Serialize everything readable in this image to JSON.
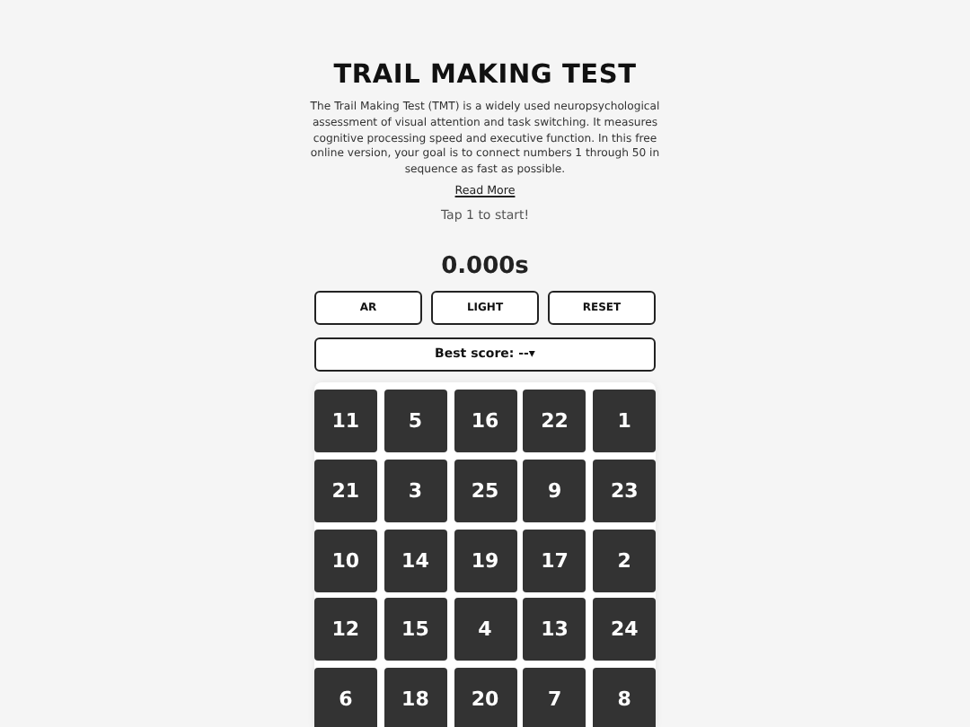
{
  "title": "TRAIL MAKING TEST",
  "description": "The Trail Making Test (TMT) is a widely used neuropsychological assessment of visual attention and task switching. It measures cognitive processing speed and executive function. In this free online version, your goal is to connect numbers 1 through 50 in sequence as fast as possible.",
  "read_more": "Read More",
  "hint": "Tap 1 to start!",
  "timer": "0.000s",
  "buttons": [
    "AR",
    "LIGHT",
    "RESET"
  ],
  "best_score": "Best score: --▾",
  "tiles": [
    "11",
    "5",
    "16",
    "22",
    "1",
    "21",
    "3",
    "25",
    "9",
    "23",
    "10",
    "14",
    "19",
    "17",
    "2",
    "12",
    "15",
    "4",
    "13",
    "24",
    "6",
    "18",
    "20",
    "7",
    "8"
  ]
}
